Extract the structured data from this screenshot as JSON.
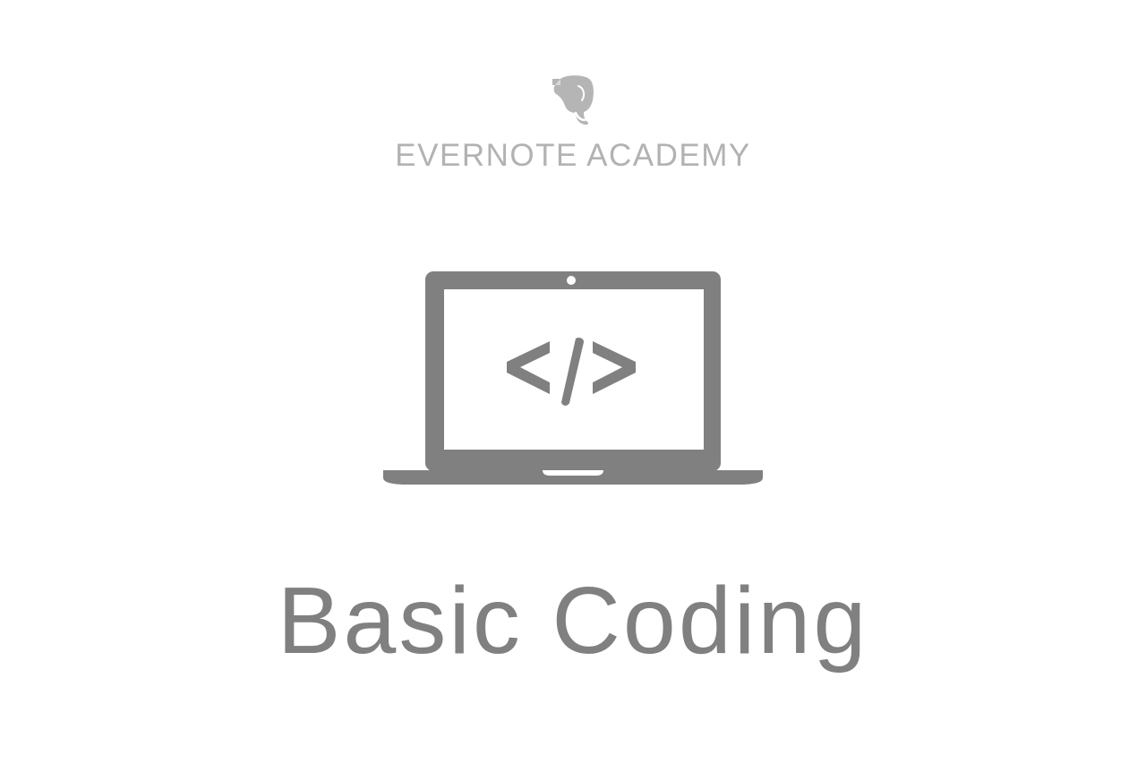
{
  "brand": {
    "logo_icon": "evernote-elephant-icon",
    "name": "EVERNOTE ACADEMY"
  },
  "illustration": {
    "icon": "laptop-code-icon",
    "screen_glyph": "</>"
  },
  "course": {
    "title": "Basic Coding"
  },
  "colors": {
    "logo": "#b5b5b5",
    "brand_text": "#b2b2b2",
    "illustration": "#808080",
    "title_text": "#808080",
    "background": "#ffffff"
  }
}
